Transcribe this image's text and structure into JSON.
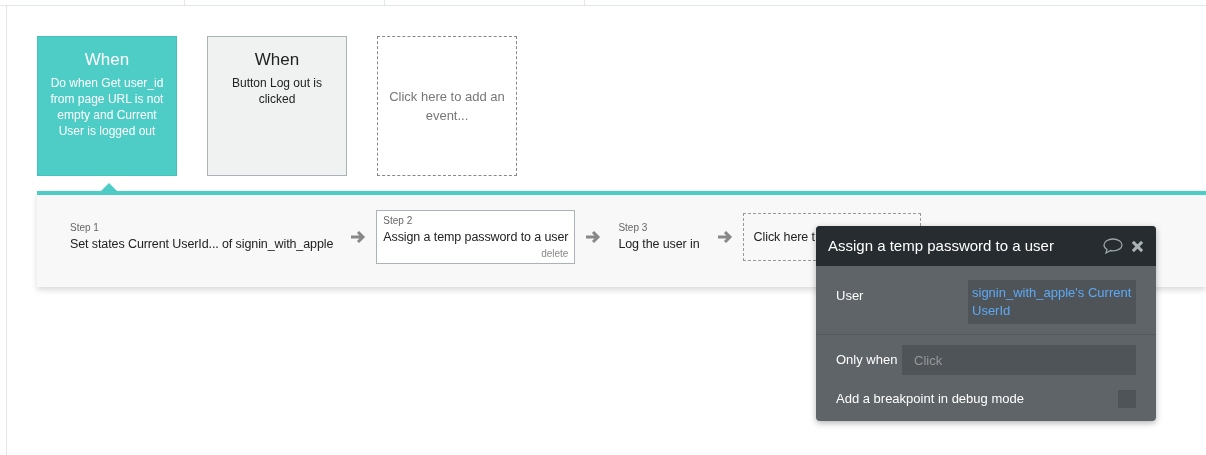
{
  "events": [
    {
      "kind": "event",
      "title": "When",
      "description": "Do when Get user_id from page URL is not empty and Current User is logged out",
      "selected": true
    },
    {
      "kind": "event",
      "title": "When",
      "description": "Button Log out is clicked",
      "selected": false
    },
    {
      "kind": "add",
      "description": "Click here to add an event..."
    }
  ],
  "steps": [
    {
      "kind": "step",
      "label": "Step 1",
      "action": "Set states Current UserId... of signin_with_apple",
      "selected": false
    },
    {
      "kind": "step",
      "label": "Step 2",
      "action": "Assign a temp password to a user",
      "selected": true,
      "delete": "delete"
    },
    {
      "kind": "step",
      "label": "Step 3",
      "action": "Log the user in",
      "selected": false
    },
    {
      "kind": "add",
      "action": "Click here t"
    }
  ],
  "popup": {
    "title": "Assign a temp password to a user",
    "user_label": "User",
    "user_value": "signin_with_apple's Current UserId",
    "only_when_label": "Only when",
    "only_when_placeholder": "Click",
    "breakpoint_label": "Add a breakpoint in debug mode",
    "breakpoint_checked": false
  }
}
